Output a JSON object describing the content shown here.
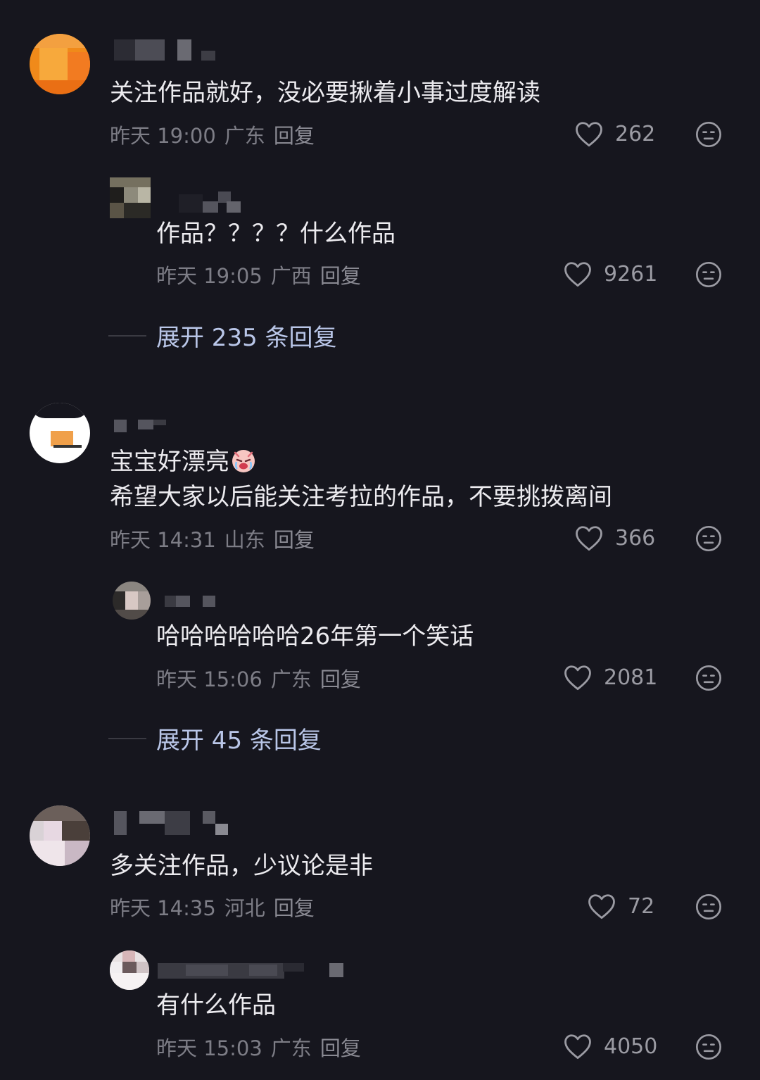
{
  "comments": [
    {
      "text": "关注作品就好，没必要揪着小事过度解读",
      "time": "昨天 19:00",
      "location": "广东",
      "reply": "回复",
      "likes": "262",
      "replies": [
        {
          "text": "作品？？？？什么作品",
          "time": "昨天 19:05",
          "location": "广西",
          "reply": "回复",
          "likes": "9261"
        }
      ],
      "expand": "展开 235 条回复"
    },
    {
      "text_line1": "宝宝好漂亮",
      "text_line2": "希望大家以后能关注考拉的作品，不要挑拨离间",
      "time": "昨天 14:31",
      "location": "山东",
      "reply": "回复",
      "likes": "366",
      "replies": [
        {
          "text": "哈哈哈哈哈哈26年第一个笑话",
          "time": "昨天 15:06",
          "location": "广东",
          "reply": "回复",
          "likes": "2081"
        }
      ],
      "expand": "展开 45 条回复"
    },
    {
      "text": "多关注作品，少议论是非",
      "time": "昨天 14:35",
      "location": "河北",
      "reply": "回复",
      "likes": "72",
      "replies": [
        {
          "text": "有什么作品",
          "time": "昨天 15:03",
          "location": "广东",
          "reply": "回复",
          "likes": "4050"
        }
      ]
    }
  ],
  "icons": {
    "like": "heart-outline-icon",
    "dislike": "meh-face-icon",
    "emoji": "crying-face-emoji"
  }
}
